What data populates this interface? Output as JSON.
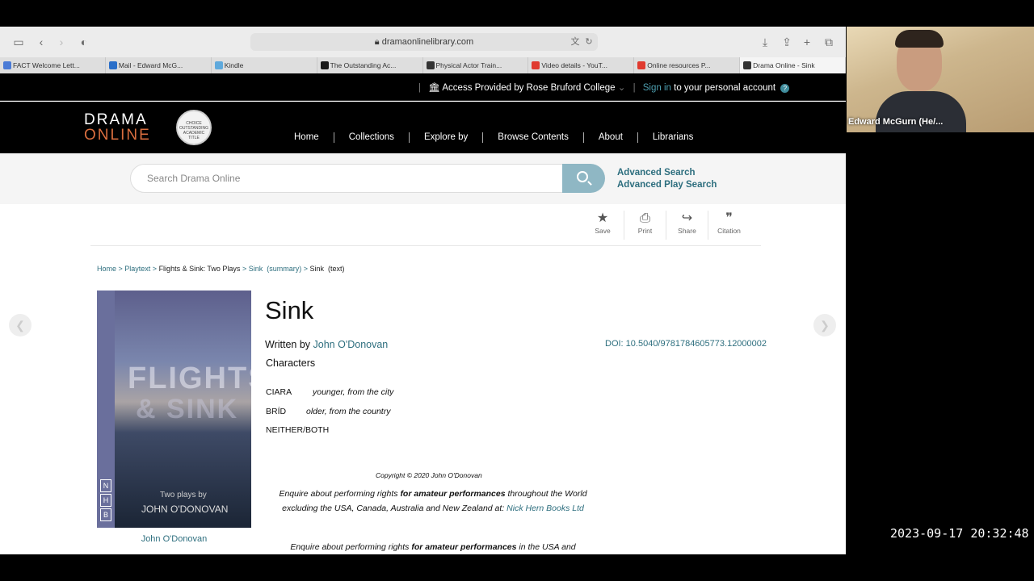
{
  "browser": {
    "url": "dramaonlinelibrary.com",
    "tabs": [
      {
        "label": "FACT Welcome Lett...",
        "color": "#4a7bd6"
      },
      {
        "label": "Mail - Edward McG...",
        "color": "#2a6fc9"
      },
      {
        "label": "Kindle",
        "color": "#5fa9dc"
      },
      {
        "label": "The Outstanding Ac...",
        "color": "#1a1a1a"
      },
      {
        "label": "Physical Actor Train...",
        "color": "#333333"
      },
      {
        "label": "Video details - YouT...",
        "color": "#e03a2f"
      },
      {
        "label": "Online resources P...",
        "color": "#e03a2f"
      },
      {
        "label": "Drama Online - Sink",
        "color": "#333333"
      }
    ]
  },
  "access_bar": {
    "provided_by": "Access Provided by Rose Bruford College",
    "sign_in": "Sign in",
    "to_account": "to your personal account",
    "help": "?"
  },
  "header": {
    "logo_line1": "DRAMA",
    "logo_line2": "ONLINE",
    "badge": "CHOICE OUTSTANDING ACADEMIC TITLE",
    "nav": [
      "Home",
      "Collections",
      "Explore by",
      "Browse Contents",
      "About",
      "Librarians"
    ]
  },
  "search": {
    "placeholder": "Search Drama Online",
    "advanced": "Advanced Search",
    "advanced_play": "Advanced Play Search"
  },
  "actions": [
    {
      "label": "Save",
      "icon": "★"
    },
    {
      "label": "Print",
      "icon": "⎙"
    },
    {
      "label": "Share",
      "icon": "↪"
    },
    {
      "label": "Citation",
      "icon": "❞"
    }
  ],
  "breadcrumb": {
    "home": "Home",
    "playtext": "Playtext",
    "book": "Flights & Sink: Two Plays",
    "sink": "Sink",
    "summary": "(summary)",
    "current": "Sink",
    "current_type": "(text)"
  },
  "cover": {
    "title1": "FLIGHTS",
    "title2": "& SINK",
    "subtitle": "Two plays by",
    "author": "JOHN O'DONOVAN",
    "publisher_letters": [
      "N",
      "H",
      "B"
    ]
  },
  "work": {
    "title": "Sink",
    "written_by": "Written by",
    "author": "John O'Donovan",
    "doi": "DOI: 10.5040/9781784605773.12000002",
    "cover_author": "John O'Donovan",
    "characters_heading": "Characters",
    "characters": [
      {
        "name": "CIARA",
        "desc": "younger, from the city"
      },
      {
        "name": "BRÍD",
        "desc": "older, from the country"
      },
      {
        "name": "NEITHER/BOTH",
        "desc": ""
      }
    ],
    "copyright": "Copyright © 2020 John O'Donovan",
    "para1_a": "Enquire about performing rights ",
    "para1_b": "for amateur performances",
    "para1_c": " throughout the World excluding the USA, Canada, Australia and New Zealand at: ",
    "para1_link": "Nick Hern Books Ltd",
    "para2_a": "Enquire about performing rights ",
    "para2_b": "for amateur performances",
    "para2_c": " in the USA and"
  },
  "overlay": {
    "participant_name": "Edward McGurn (He/...",
    "timestamp": "2023-09-17  20:32:48"
  }
}
